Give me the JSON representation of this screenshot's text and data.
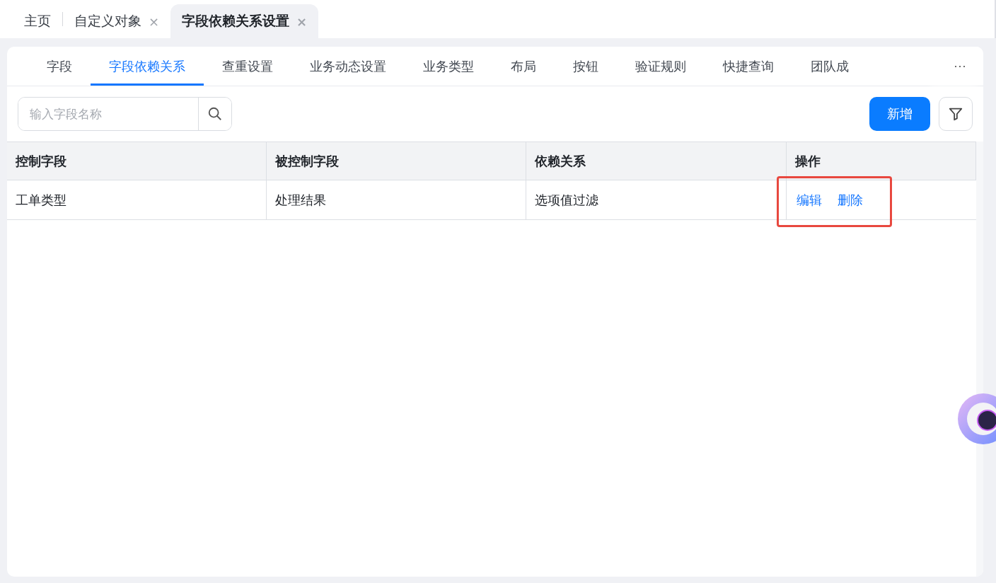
{
  "page_tabs": [
    {
      "label": "主页",
      "selected": false
    },
    {
      "label": "自定义对象",
      "selected": false,
      "close": "×"
    },
    {
      "label": "字段依赖关系设置",
      "selected": true,
      "close": "×"
    }
  ],
  "sub_tabs": [
    {
      "label": "字段",
      "selected": false
    },
    {
      "label": "字段依赖关系",
      "selected": true
    },
    {
      "label": "查重设置",
      "selected": false
    },
    {
      "label": "业务动态设置",
      "selected": false
    },
    {
      "label": "业务类型",
      "selected": false
    },
    {
      "label": "布局",
      "selected": false
    },
    {
      "label": "按钮",
      "selected": false
    },
    {
      "label": "验证规则",
      "selected": false
    },
    {
      "label": "快捷查询",
      "selected": false
    },
    {
      "label": "团队成",
      "selected": false
    }
  ],
  "more": "···",
  "search": {
    "placeholder": "输入字段名称"
  },
  "add_button": "新增",
  "table": {
    "columns": [
      "控制字段",
      "被控制字段",
      "依赖关系",
      "操作"
    ],
    "rows": [
      {
        "cells": [
          "工单类型",
          "处理结果",
          "选项值过滤"
        ],
        "actions": [
          "编辑",
          "删除"
        ],
        "highlighted": true
      }
    ]
  }
}
